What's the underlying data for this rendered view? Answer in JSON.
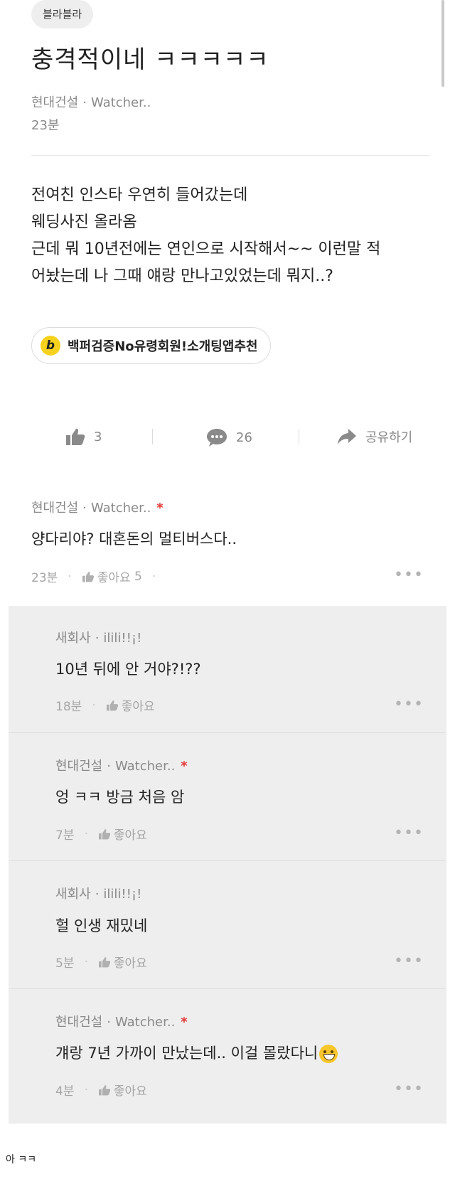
{
  "post": {
    "tag": "블라블라",
    "title": "충격적이네 ㅋㅋㅋㅋㅋ",
    "author_company": "현대건설",
    "author_name": "Watcher..",
    "time": "23분",
    "body_lines": [
      "전여친 인스타 우연히 들어갔는데",
      "웨딩사진 올라옴",
      "근데 뭐 10년전에는 연인으로 시작해서~~ 이런말 적",
      "어놨는데 나 그때 얘랑 만나고있었는데 뭐지..?"
    ]
  },
  "promo": {
    "icon_letter": "b",
    "label": "백퍼검증No유령회원!소개팅앱추천"
  },
  "actions": {
    "like_count": "3",
    "comment_count": "26",
    "share_label": "공유하기"
  },
  "comments": [
    {
      "company": "현대건설",
      "name": "Watcher..",
      "is_author": true,
      "author_mark": "*",
      "text": "양다리야? 대혼돈의 멀티버스다..",
      "time": "23분",
      "like_label": "좋아요",
      "like_count": "5"
    }
  ],
  "replies": [
    {
      "company": "새회사",
      "name": "ilili!!¡!",
      "is_author": false,
      "text": "10년 뒤에 안 거야?!??",
      "time": "18분",
      "like_label": "좋아요"
    },
    {
      "company": "현대건설",
      "name": "Watcher..",
      "is_author": true,
      "author_mark": "*",
      "text": "엉 ㅋㅋ 방금 처음 암",
      "time": "7분",
      "like_label": "좋아요"
    },
    {
      "company": "새회사",
      "name": "ilili!!¡!",
      "is_author": false,
      "text": "헐 인생 재밌네",
      "time": "5분",
      "like_label": "좋아요"
    },
    {
      "company": "현대건설",
      "name": "Watcher..",
      "is_author": true,
      "author_mark": "*",
      "text": "걔랑 7년 가까이 만났는데.. 이걸 몰랐다니",
      "emoji": "grinning-sweat-emoji",
      "time": "4분",
      "like_label": "좋아요"
    }
  ],
  "caption": "아 ㅋㅋ",
  "colors": {
    "author_star": "#e53935",
    "promo_icon": "#f6d21e",
    "reply_bg": "#eeeeee"
  },
  "icons": {
    "like": "thumbs-up-icon",
    "comment": "speech-bubble-icon",
    "share": "share-arrow-icon",
    "more": "more-dots-icon"
  }
}
